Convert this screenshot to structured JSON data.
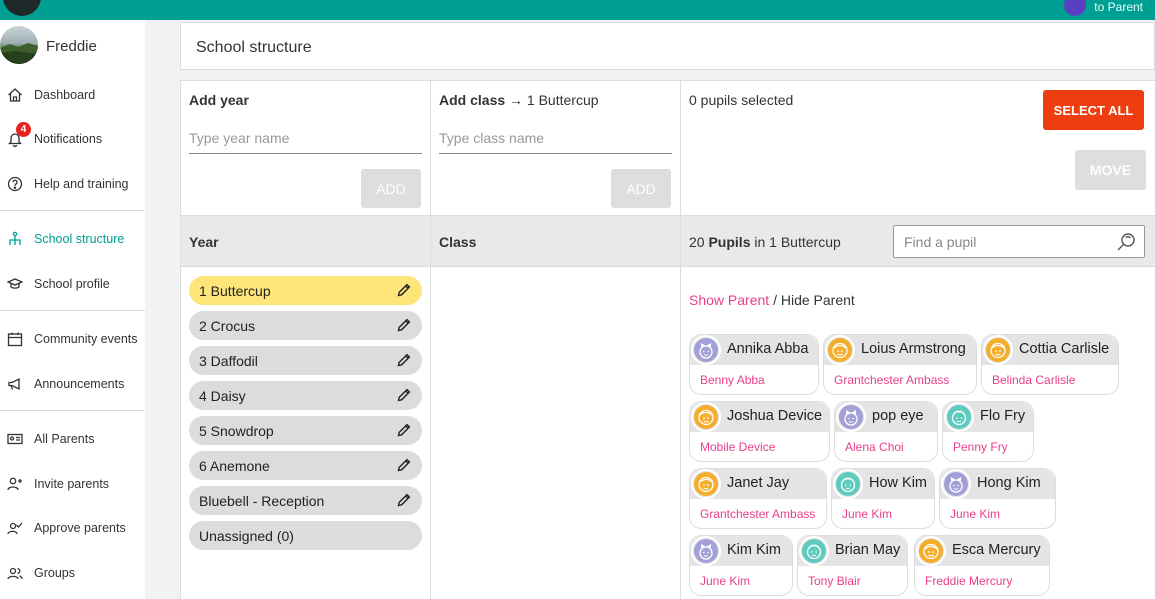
{
  "topbar": {
    "switch_label": "to Parent"
  },
  "user": {
    "name": "Freddie"
  },
  "nav": {
    "dashboard": "Dashboard",
    "notifications": "Notifications",
    "notifications_count": "4",
    "help": "Help and training",
    "school_structure": "School structure",
    "school_profile": "School profile",
    "community_events": "Community events",
    "announcements": "Announcements",
    "all_parents": "All Parents",
    "invite_parents": "Invite parents",
    "approve_parents": "Approve parents",
    "groups": "Groups"
  },
  "page": {
    "title": "School structure"
  },
  "add_year": {
    "label": "Add year",
    "placeholder": "Type year name",
    "button": "ADD"
  },
  "add_class": {
    "label": "Add class",
    "arrow": "→",
    "target": "1 Buttercup",
    "placeholder": "Type class name",
    "button": "ADD"
  },
  "selection": {
    "text": "0 pupils selected",
    "select_all": "SELECT ALL",
    "move": "MOVE"
  },
  "columns": {
    "year": "Year",
    "class": "Class"
  },
  "pupils_header": {
    "count": "20",
    "label": "Pupils",
    "in": "in",
    "class_name": "1 Buttercup",
    "search_placeholder": "Find a pupil"
  },
  "years": [
    {
      "name": "1 Buttercup",
      "selected": true,
      "editable": true
    },
    {
      "name": "2 Crocus",
      "selected": false,
      "editable": true
    },
    {
      "name": "3 Daffodil",
      "selected": false,
      "editable": true
    },
    {
      "name": "4 Daisy",
      "selected": false,
      "editable": true
    },
    {
      "name": "5 Snowdrop",
      "selected": false,
      "editable": true
    },
    {
      "name": "6 Anemone",
      "selected": false,
      "editable": true
    },
    {
      "name": "Bluebell - Reception",
      "selected": false,
      "editable": true
    },
    {
      "name": "Unassigned (0)",
      "selected": false,
      "editable": false
    }
  ],
  "parent_toggle": {
    "show": "Show Parent",
    "separator": "/",
    "hide": "Hide Parent"
  },
  "pupils": [
    {
      "name": "Annika Abba",
      "parent": "Benny Abba",
      "avatar": "girl-face-icon",
      "color": "#a3a0d8"
    },
    {
      "name": "Loius Armstrong",
      "parent": "Grantchester Ambass",
      "avatar": "boy-face-icon",
      "color": "#f5ad2a"
    },
    {
      "name": "Cottia Carlisle",
      "parent": "Belinda Carlisle",
      "avatar": "boy-face-icon",
      "color": "#f5ad2a"
    },
    {
      "name": "Joshua Device",
      "parent": "Mobile Device",
      "avatar": "boy-face-icon",
      "color": "#f5ad2a"
    },
    {
      "name": "pop eye",
      "parent": "Alena Choi",
      "avatar": "girl-face-icon",
      "color": "#a3a0d8"
    },
    {
      "name": "Flo Fry",
      "parent": "Penny Fry",
      "avatar": "teal-face-icon",
      "color": "#5fcbbf"
    },
    {
      "name": "Janet Jay",
      "parent": "Grantchester Ambass",
      "avatar": "boy-face-icon",
      "color": "#f5ad2a"
    },
    {
      "name": "How Kim",
      "parent": "June Kim",
      "avatar": "teal-face-icon",
      "color": "#5fcbbf"
    },
    {
      "name": "Hong Kim",
      "parent": "June Kim",
      "avatar": "girl-face-icon",
      "color": "#a3a0d8"
    },
    {
      "name": "Kim Kim",
      "parent": "June Kim",
      "avatar": "girl-face-icon",
      "color": "#a3a0d8"
    },
    {
      "name": "Brian May",
      "parent": "Tony Blair",
      "avatar": "teal-face-icon",
      "color": "#5fcbbf"
    },
    {
      "name": "Esca Mercury",
      "parent": "Freddie Mercury",
      "avatar": "boy-face-icon",
      "color": "#f5ad2a"
    }
  ],
  "colors": {
    "brand": "#009f93",
    "accent": "#ee3e11",
    "parent_link": "#e83e8c",
    "selected_year": "#fde57a"
  }
}
